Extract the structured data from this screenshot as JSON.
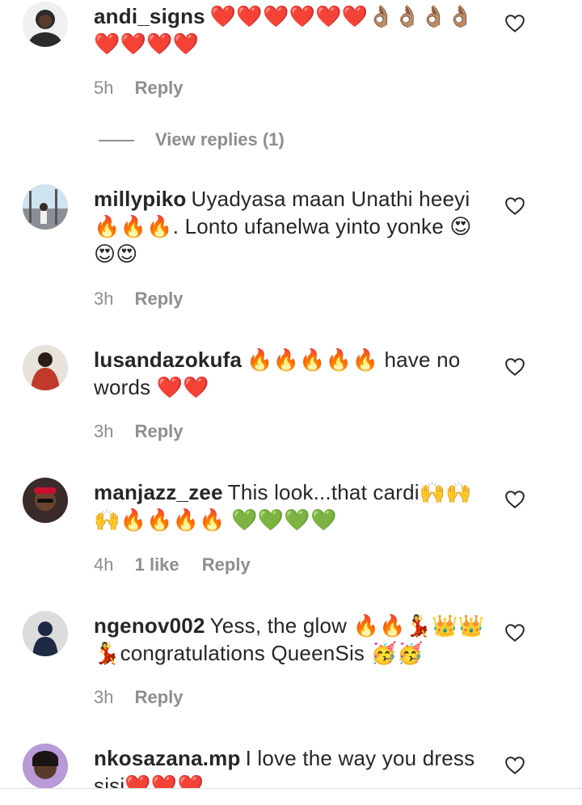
{
  "colors": {
    "meta": "#8e8e8e",
    "text": "#262626",
    "heart": "#e0221f",
    "green_heart": "#4fc928",
    "fire": "#ff6a00"
  },
  "comments": [
    {
      "username": "andi_signs",
      "text": "❤️❤️❤️❤️❤️❤️👌🏽👌🏽👌🏽👌🏽❤️❤️❤️❤️",
      "time": "5h",
      "likes": "",
      "reply": "Reply",
      "view_replies": "View replies (1)"
    },
    {
      "username": "millypiko",
      "text": "Uyadyasa maan Unathi heeyi 🔥🔥🔥. Lonto ufanelwa yinto yonke 😍😍😍",
      "time": "3h",
      "likes": "",
      "reply": "Reply"
    },
    {
      "username": "lusandazokufa",
      "text": "🔥🔥🔥🔥🔥 have no words ❤️❤️",
      "time": "3h",
      "likes": "",
      "reply": "Reply"
    },
    {
      "username": "manjazz_zee",
      "text": "This look...that cardi🙌🙌🙌🔥🔥🔥🔥 💚💚💚💚",
      "time": "4h",
      "likes": "1 like",
      "reply": "Reply"
    },
    {
      "username": "ngenov002",
      "text": "Yess, the glow 🔥🔥💃👑👑💃congratulations QueenSis 🥳🥳",
      "time": "3h",
      "likes": "",
      "reply": "Reply"
    },
    {
      "username": "nkosazana.mp",
      "text": "I love the way you dress sisi❤️❤️❤️",
      "time": "",
      "likes": "",
      "reply": ""
    }
  ]
}
